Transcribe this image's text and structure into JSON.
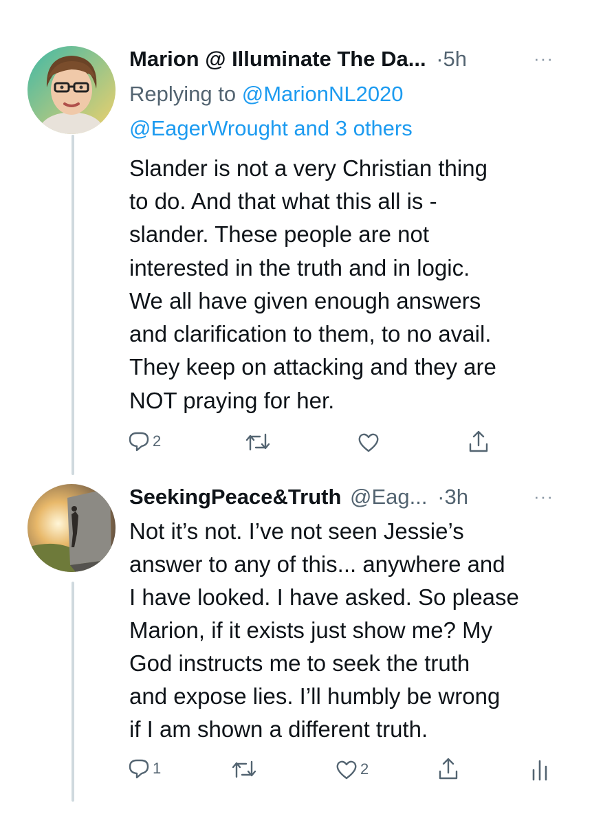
{
  "tweet1": {
    "display_name": "Marion @ Illuminate The Da...",
    "sep": "·",
    "time": "5h",
    "more": "···",
    "reply_prefix": "Replying to",
    "reply_handle": "@MarionNL2020",
    "reply_line2": "@EagerWrought and 3 others",
    "lines": [
      "Slander is not a very Christian thing",
      "to do. And that what this all is -",
      "slander. These people are not",
      "interested in the truth and in logic.",
      "We all have given enough answers",
      "and clarification to them, to no avail.",
      "They keep on attacking and they are",
      "NOT praying for her."
    ],
    "reply_count": "2",
    "like_count": ""
  },
  "tweet2": {
    "display_name": "SeekingPeace&Truth",
    "handle": "@Eag...",
    "sep": "·",
    "time": "3h",
    "more": "···",
    "lines": [
      "Not it’s not. I’ve not seen Jessie’s",
      "answer to any of this... anywhere and",
      "I have looked. I have asked. So please",
      "Marion, if it exists just show me? My",
      "God instructs me to seek the truth",
      "and expose lies. I’ll humbly be wrong",
      "if I am shown a different truth."
    ],
    "reply_count": "1",
    "like_count": "2"
  },
  "colors": {
    "link": "#1d9bf0",
    "secondary": "#536471",
    "thread_line": "#cfd9de"
  },
  "icons": [
    "reply-icon",
    "retweet-icon",
    "like-icon",
    "share-icon",
    "analytics-icon",
    "more-icon"
  ]
}
